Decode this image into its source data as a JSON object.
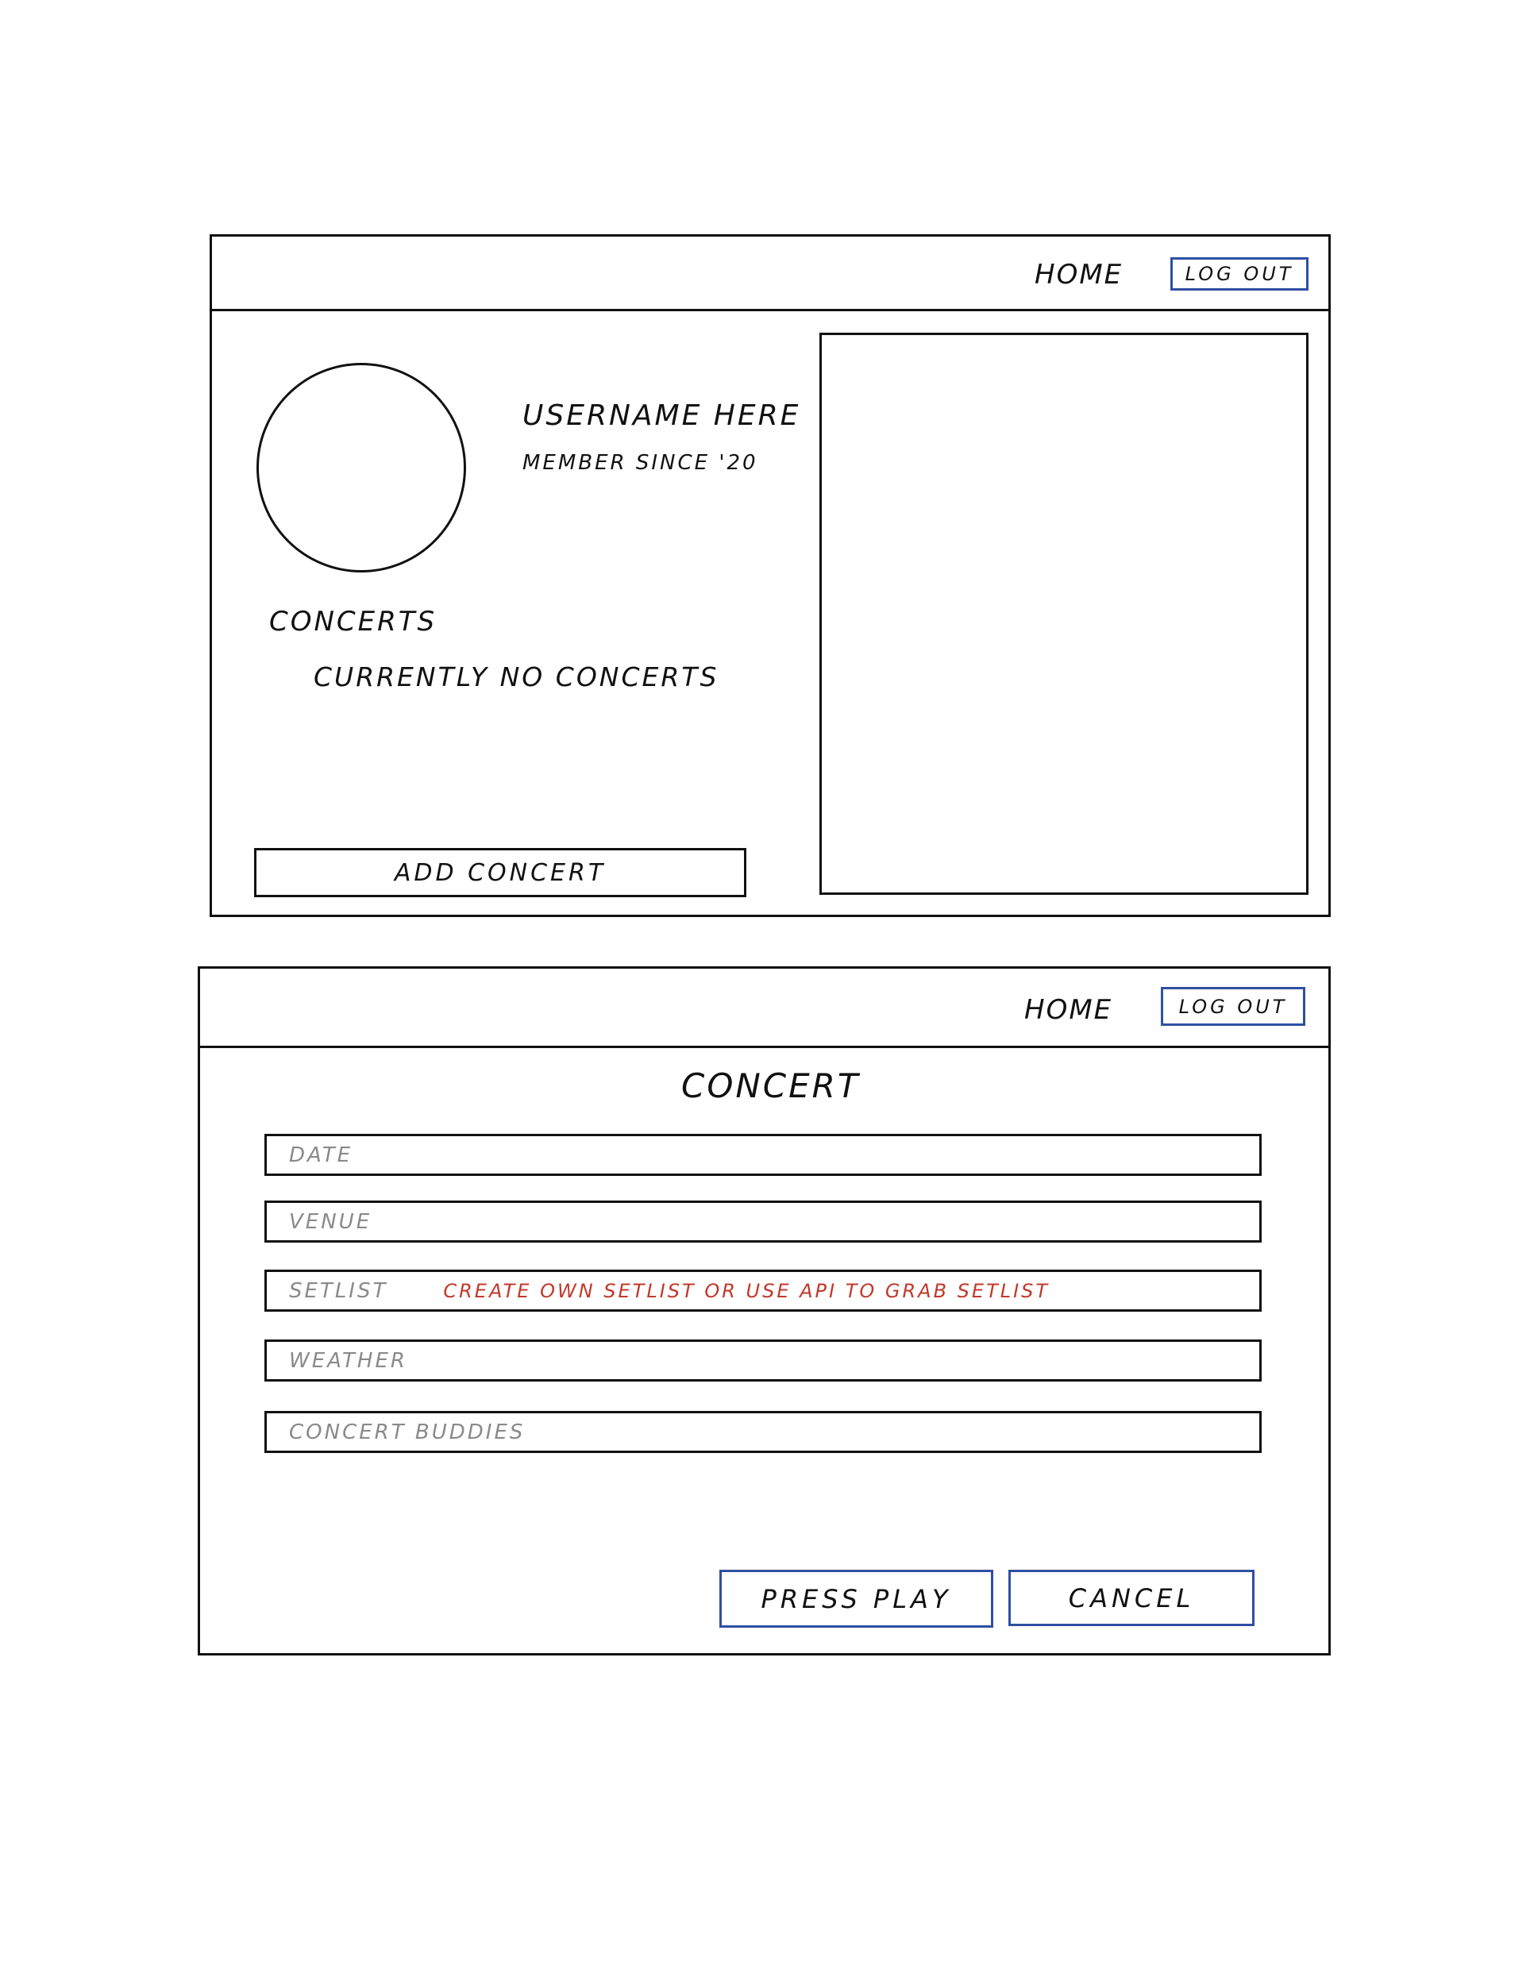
{
  "profile_screen": {
    "nav": {
      "home_label": "HOME",
      "logout_label": "LOG OUT"
    },
    "username": "USERNAME HERE",
    "member_since": "MEMBER SINCE '20",
    "concerts_heading": "CONCERTS",
    "concerts_empty": "CURRENTLY NO CONCERTS",
    "add_concert_label": "ADD CONCERT"
  },
  "concert_screen": {
    "nav": {
      "home_label": "HOME",
      "logout_label": "LOG OUT"
    },
    "title": "CONCERT",
    "fields": [
      {
        "placeholder": "DATE"
      },
      {
        "placeholder": "VENUE"
      },
      {
        "placeholder": "SETLIST",
        "note": "CREATE OWN SETLIST OR USE API TO GRAB SETLIST"
      },
      {
        "placeholder": "WEATHER"
      },
      {
        "placeholder": "CONCERT BUDDIES"
      }
    ],
    "press_play_label": "PRESS PLAY",
    "cancel_label": "CANCEL"
  },
  "colors": {
    "ink": "#111111",
    "button_border": "#2f4fa2",
    "placeholder_text": "#8a8a8a",
    "annotation_red": "#c0392b"
  }
}
